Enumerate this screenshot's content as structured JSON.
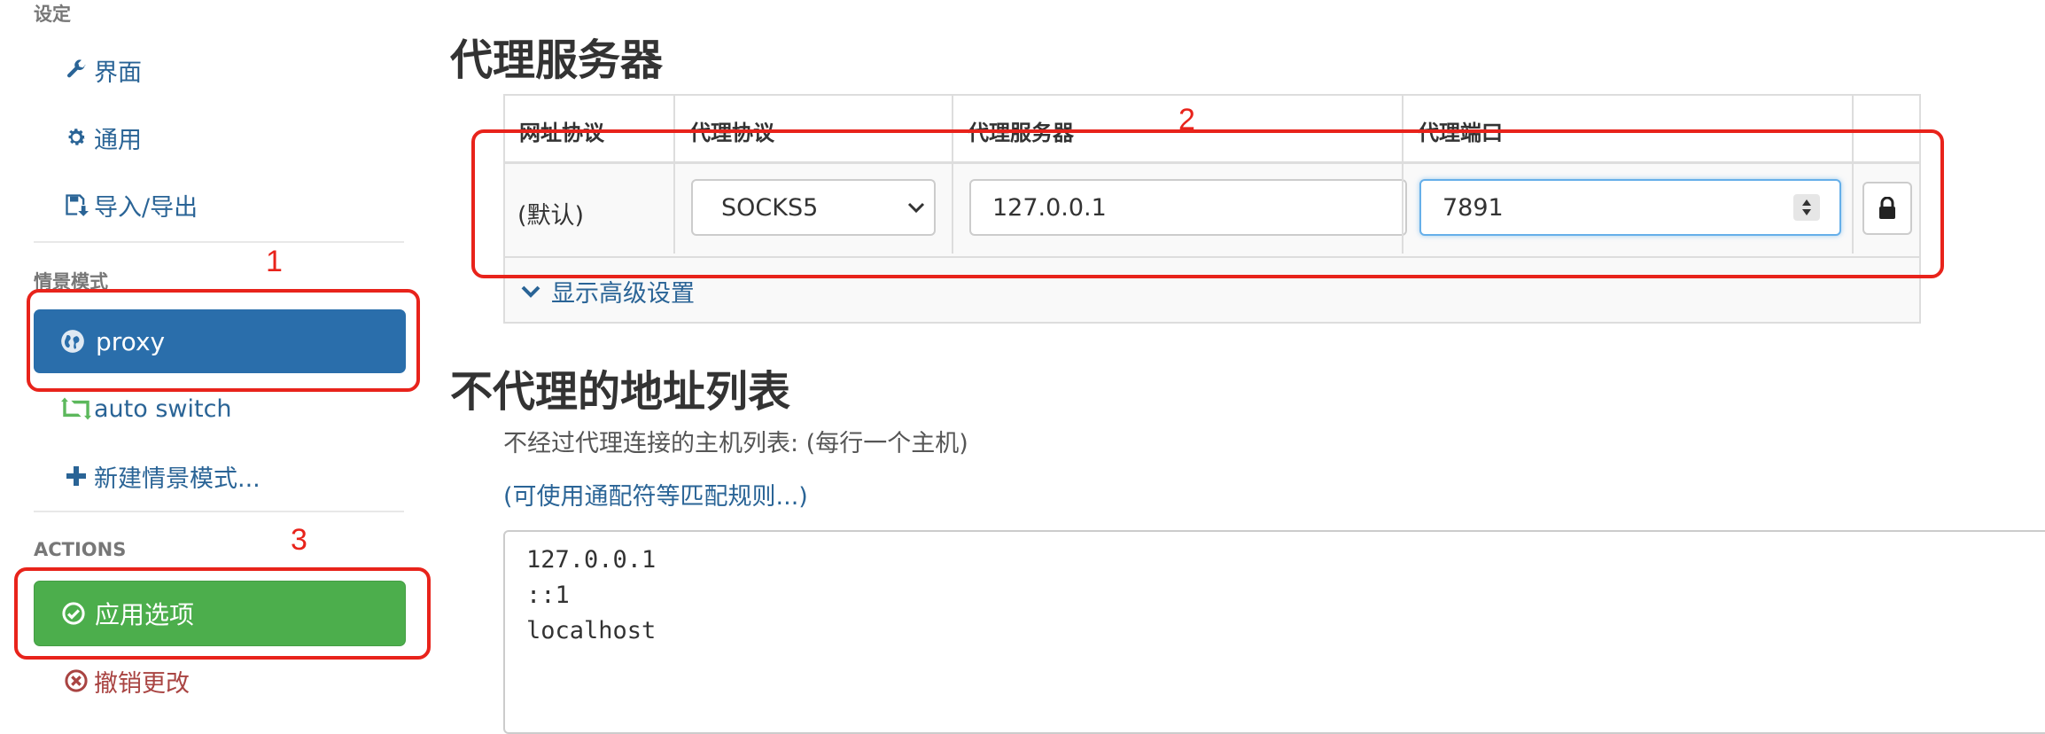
{
  "sidebar": {
    "settings_header": "设定",
    "settings_items": [
      {
        "label": "界面",
        "icon": "wrench-icon"
      },
      {
        "label": "通用",
        "icon": "gear-icon"
      },
      {
        "label": "导入/导出",
        "icon": "floppy-icon"
      }
    ],
    "profiles_header": "情景模式",
    "profiles": [
      {
        "label": "proxy",
        "icon": "globe-icon",
        "active": true
      },
      {
        "label": "auto switch",
        "icon": "retweet-icon"
      },
      {
        "label": "新建情景模式...",
        "icon": "plus-icon"
      }
    ],
    "actions_header": "ACTIONS",
    "apply_label": "应用选项",
    "revert_label": "撤销更改"
  },
  "main": {
    "proxy_section_title": "代理服务器",
    "table": {
      "headers": [
        "网址协议",
        "代理协议",
        "代理服务器",
        "代理端口"
      ],
      "row": {
        "scheme": "(默认)",
        "protocol": "SOCKS5",
        "server": "127.0.0.1",
        "port": "7891"
      },
      "advanced_link": "显示高级设置"
    },
    "bypass_section_title": "不代理的地址列表",
    "bypass_help": "不经过代理连接的主机列表: (每行一个主机)",
    "bypass_rules_link": "(可使用通配符等匹配规则...)",
    "bypass_list": "127.0.0.1\n::1\nlocalhost"
  },
  "annotations": [
    "1",
    "2",
    "3"
  ],
  "colors": {
    "primary": "#2a6eab",
    "success": "#4cae4c",
    "link": "#2a6496",
    "danger": "#a94442",
    "annotation": "#e8231b"
  }
}
